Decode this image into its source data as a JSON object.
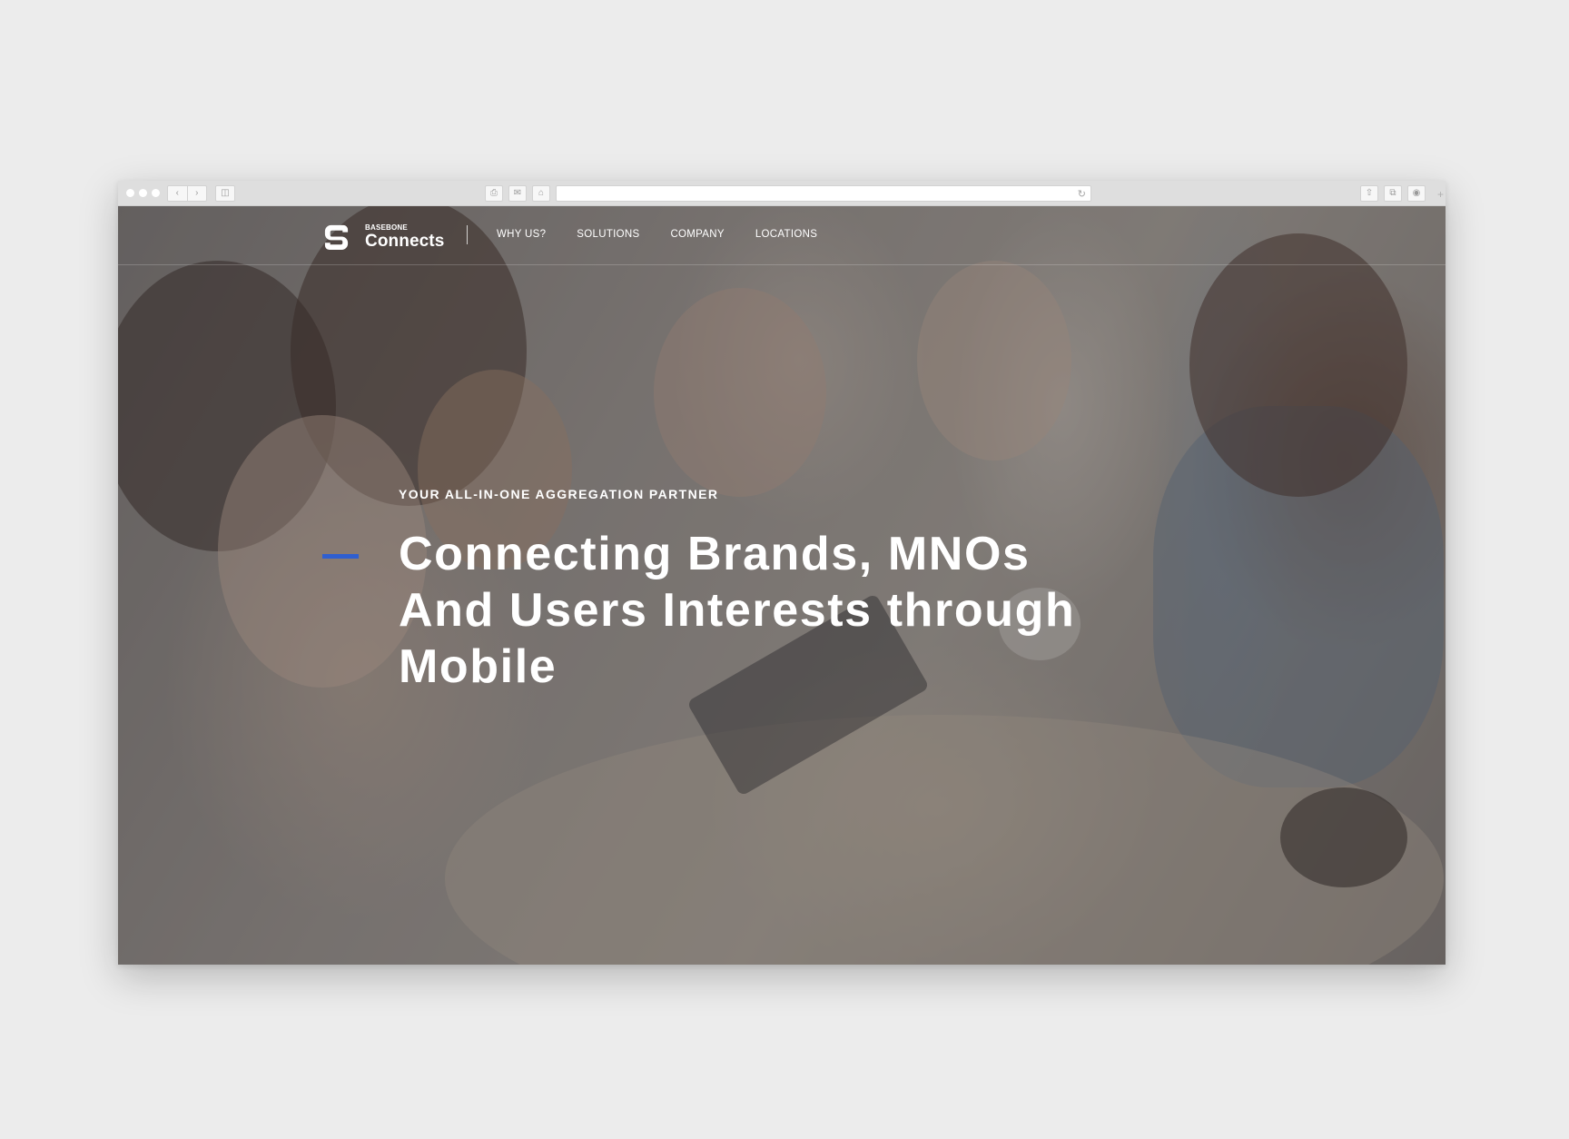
{
  "browser": {
    "window_dots": 3,
    "back_icon": "chevron-left-icon",
    "forward_icon": "chevron-right-icon",
    "address_value": ""
  },
  "site": {
    "logo": {
      "small_text": "BASEBONE",
      "big_text": "Connects"
    },
    "nav": {
      "items": [
        {
          "label": "WHY US?"
        },
        {
          "label": "SOLUTIONS"
        },
        {
          "label": "COMPANY"
        },
        {
          "label": "LOCATIONS"
        }
      ]
    },
    "hero": {
      "eyebrow": "YOUR ALL-IN-ONE AGGREGATION PARTNER",
      "headline_line1": "Connecting Brands, MNOs",
      "headline_line2": "And Users Interests through",
      "headline_line3": "Mobile"
    }
  },
  "colors": {
    "accent": "#2f5fd0",
    "page_background": "#ececec",
    "chrome": "#dedede"
  }
}
